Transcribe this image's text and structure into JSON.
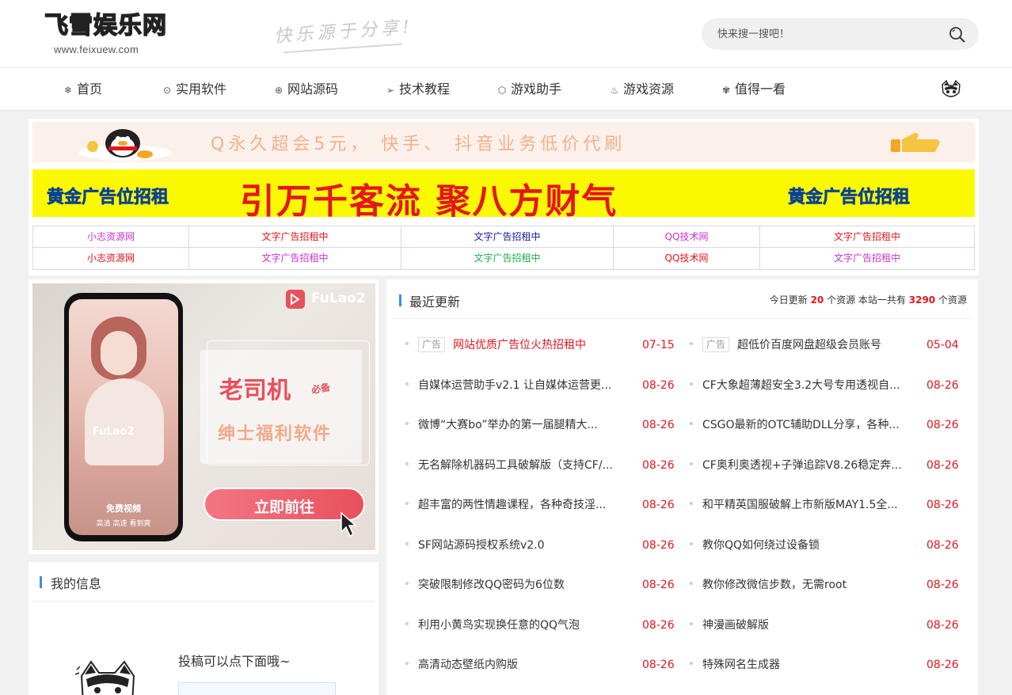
{
  "header": {
    "logo_text": "飞雪娱乐网",
    "logo_domain": "www.feixuew.com",
    "slogan": "快乐源于分享!",
    "search_placeholder": "快来搜一搜吧！"
  },
  "nav": {
    "items": [
      {
        "label": "首页",
        "icon": "snowflake-icon",
        "glyph": "❄"
      },
      {
        "label": "实用软件",
        "icon": "download-circle-icon",
        "glyph": "⊙"
      },
      {
        "label": "网站源码",
        "icon": "globe-icon",
        "glyph": "⊕"
      },
      {
        "label": "技术教程",
        "icon": "paper-plane-icon",
        "glyph": "➢"
      },
      {
        "label": "游戏助手",
        "icon": "cube-icon",
        "glyph": "⬡"
      },
      {
        "label": "游戏资源",
        "icon": "fire-icon",
        "glyph": "♨"
      },
      {
        "label": "值得一看",
        "icon": "palm-tree-icon",
        "glyph": "✾"
      }
    ]
  },
  "banners": {
    "banner1_text": "Q永久超会5元， 快手、 抖音业务低价代刷",
    "banner2_side_left": "黄金广告位招租",
    "banner2_main": "引万千客流  聚八方财气",
    "banner2_side_right": "黄金广告位招租"
  },
  "text_ads": {
    "row1": [
      {
        "text": "小志资源网",
        "color": "#cc33cc"
      },
      {
        "text": "文字广告招租中",
        "color": "#e4161d"
      },
      {
        "text": "文字广告招租中",
        "color": "#1a1a99"
      },
      {
        "text": "QQ技术网",
        "color": "#cc33cc"
      },
      {
        "text": "文字广告招租中",
        "color": "#e4161d"
      }
    ],
    "row2": [
      {
        "text": "小志资源网",
        "color": "#e4161d"
      },
      {
        "text": "文字广告招租中",
        "color": "#cc33cc"
      },
      {
        "text": "文字广告招租中",
        "color": "#22aa55"
      },
      {
        "text": "QQ技术网",
        "color": "#e4161d"
      },
      {
        "text": "文字广告招租中",
        "color": "#cc33cc"
      }
    ]
  },
  "left_ad": {
    "brand": "FuLao2",
    "headline": "老司机",
    "badge": "必备",
    "subline": "绅士福利软件",
    "phone_caption": "免费视频",
    "phone_sub": "高清 高速 看到爽",
    "cta": "立即前往"
  },
  "my_info": {
    "title": "我的信息",
    "tip": "投稿可以点下面哦~"
  },
  "recent": {
    "title": "最近更新",
    "stats_prefix": "今日更新",
    "today_count": "20",
    "stats_mid": "个资源 本站一共有",
    "total_count": "3290",
    "stats_suffix": "个资源",
    "ad_tag": "广告",
    "posts": [
      {
        "title": "网站优质广告位火热招租中",
        "date": "07-15",
        "tag": true,
        "red": true
      },
      {
        "title": "超低价百度网盘超级会员账号",
        "date": "05-04",
        "tag": true,
        "red": false
      },
      {
        "title": "自媒体运营助手v2.1 让自媒体运营更...",
        "date": "08-26"
      },
      {
        "title": "CF大象超薄超安全3.2大号专用透视自...",
        "date": "08-26"
      },
      {
        "title": "微博“大赛bo”举办的第一届腿精大...",
        "date": "08-26"
      },
      {
        "title": "CSGO最新的OTC辅助DLL分享，各种...",
        "date": "08-26"
      },
      {
        "title": "无名解除机器码工具破解版（支持CF/...",
        "date": "08-26"
      },
      {
        "title": "CF奥利奥透视+子弹追踪V8.26稳定奔...",
        "date": "08-26"
      },
      {
        "title": "超丰富的两性情趣课程，各种奇技淫...",
        "date": "08-26"
      },
      {
        "title": "和平精英国服破解上市新版MAY1.5全...",
        "date": "08-26"
      },
      {
        "title": "SF网站源码授权系统v2.0",
        "date": "08-26"
      },
      {
        "title": "教你QQ如何绕过设备锁",
        "date": "08-26"
      },
      {
        "title": "突破限制修改QQ密码为6位数",
        "date": "08-26"
      },
      {
        "title": "教你修改微信步数，无需root",
        "date": "08-26"
      },
      {
        "title": "利用小黄鸟实现换任意的QQ气泡",
        "date": "08-26"
      },
      {
        "title": "神漫画破解版",
        "date": "08-26"
      },
      {
        "title": "高清动态壁纸内购版",
        "date": "08-26"
      },
      {
        "title": "特殊网名生成器",
        "date": "08-26"
      }
    ]
  }
}
